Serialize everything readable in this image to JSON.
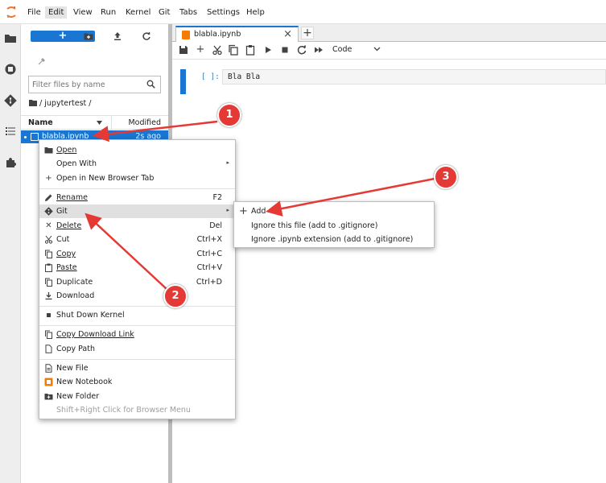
{
  "menubar": {
    "items": [
      "File",
      "Edit",
      "View",
      "Run",
      "Kernel",
      "Git",
      "Tabs",
      "Settings",
      "Help"
    ],
    "active_item": "Edit"
  },
  "filebrowser": {
    "new_button_label": "+",
    "filter_placeholder": "Filter files by name",
    "breadcrumb": "/ jupytertest /",
    "columns": {
      "name": "Name",
      "modified": "Modified"
    },
    "file": {
      "name": "blabla.ipynb",
      "modified": "2s ago"
    }
  },
  "notebook": {
    "tab_title": "blabla.ipynb",
    "cell_type": "Code",
    "cell_prompt": "[ ]:",
    "cell_source": "Bla Bla"
  },
  "context_menu": {
    "items": [
      {
        "label": "Open",
        "shortcut": ""
      },
      {
        "label": "Open With",
        "shortcut": ""
      },
      {
        "label": "Open in New Browser Tab",
        "shortcut": ""
      },
      {
        "label": "Rename",
        "shortcut": "F2"
      },
      {
        "label": "Git",
        "shortcut": ""
      },
      {
        "label": "Delete",
        "shortcut": "Del"
      },
      {
        "label": "Cut",
        "shortcut": "Ctrl+X"
      },
      {
        "label": "Copy",
        "shortcut": "Ctrl+C"
      },
      {
        "label": "Paste",
        "shortcut": "Ctrl+V"
      },
      {
        "label": "Duplicate",
        "shortcut": "Ctrl+D"
      },
      {
        "label": "Download",
        "shortcut": ""
      },
      {
        "label": "Shut Down Kernel",
        "shortcut": ""
      },
      {
        "label": "Copy Download Link",
        "shortcut": ""
      },
      {
        "label": "Copy Path",
        "shortcut": ""
      },
      {
        "label": "New File",
        "shortcut": ""
      },
      {
        "label": "New Notebook",
        "shortcut": ""
      },
      {
        "label": "New Folder",
        "shortcut": ""
      },
      {
        "label": "Shift+Right Click for Browser Menu",
        "shortcut": ""
      }
    ],
    "highlighted": "Git"
  },
  "git_submenu": {
    "items": [
      {
        "label": "Add"
      },
      {
        "label": "Ignore this file (add to .gitignore)"
      },
      {
        "label": "Ignore .ipynb extension (add to .gitignore)"
      }
    ]
  },
  "annotations": {
    "badges": [
      "1",
      "2",
      "3"
    ],
    "color": "#e53935"
  },
  "colors": {
    "accent": "#1976d2",
    "notebook_icon": "#f57c00"
  }
}
